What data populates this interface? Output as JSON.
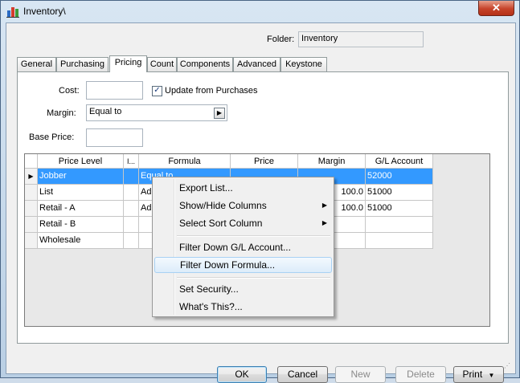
{
  "window": {
    "title": "Inventory\\",
    "close_label": "✕"
  },
  "folder": {
    "label": "Folder:",
    "value": "Inventory"
  },
  "tabs": [
    {
      "label": "General"
    },
    {
      "label": "Purchasing"
    },
    {
      "label": "Pricing"
    },
    {
      "label": "Count"
    },
    {
      "label": "Components"
    },
    {
      "label": "Advanced"
    },
    {
      "label": "Keystone"
    }
  ],
  "active_tab": "Pricing",
  "pricing": {
    "cost_label": "Cost:",
    "cost_value": "",
    "update_label": "Update from Purchases",
    "update_checked": "✓",
    "margin_label": "Margin:",
    "margin_value": "Equal to",
    "margin_arrow": "▶",
    "base_price_label": "Base Price:",
    "base_price_value": ""
  },
  "grid": {
    "columns": [
      {
        "label": "Price Level"
      },
      {
        "label": "I..."
      },
      {
        "label": "Formula"
      },
      {
        "label": "Price"
      },
      {
        "label": "Margin"
      },
      {
        "label": "G/L Account"
      }
    ],
    "current_row_marker": "▶",
    "rows": [
      {
        "level": "Jobber",
        "formula": "Equal to",
        "price": "",
        "margin": "",
        "gl": "52000"
      },
      {
        "level": "List",
        "formula": "Ad",
        "price": "",
        "margin": "100.0",
        "gl": "51000"
      },
      {
        "level": "Retail - A",
        "formula": "Ad",
        "price": "",
        "margin": "100.0",
        "gl": "51000"
      },
      {
        "level": "Retail - B",
        "formula": "",
        "price": "",
        "margin": "",
        "gl": ""
      },
      {
        "level": "Wholesale",
        "formula": "",
        "price": "",
        "margin": "",
        "gl": ""
      }
    ]
  },
  "context_menu": {
    "items": [
      {
        "label": "Export List..."
      },
      {
        "label": "Show/Hide Columns"
      },
      {
        "label": "Select Sort Column"
      },
      {
        "label": "Filter Down G/L Account..."
      },
      {
        "label": "Filter Down Formula..."
      },
      {
        "label": "Set Security..."
      },
      {
        "label": "What's This?..."
      }
    ],
    "submenu_arrow": "▶",
    "highlighted": "Filter Down Formula..."
  },
  "buttons": {
    "ok": "OK",
    "cancel": "Cancel",
    "new": "New",
    "delete": "Delete",
    "print": "Print",
    "print_arrow": "▼"
  }
}
